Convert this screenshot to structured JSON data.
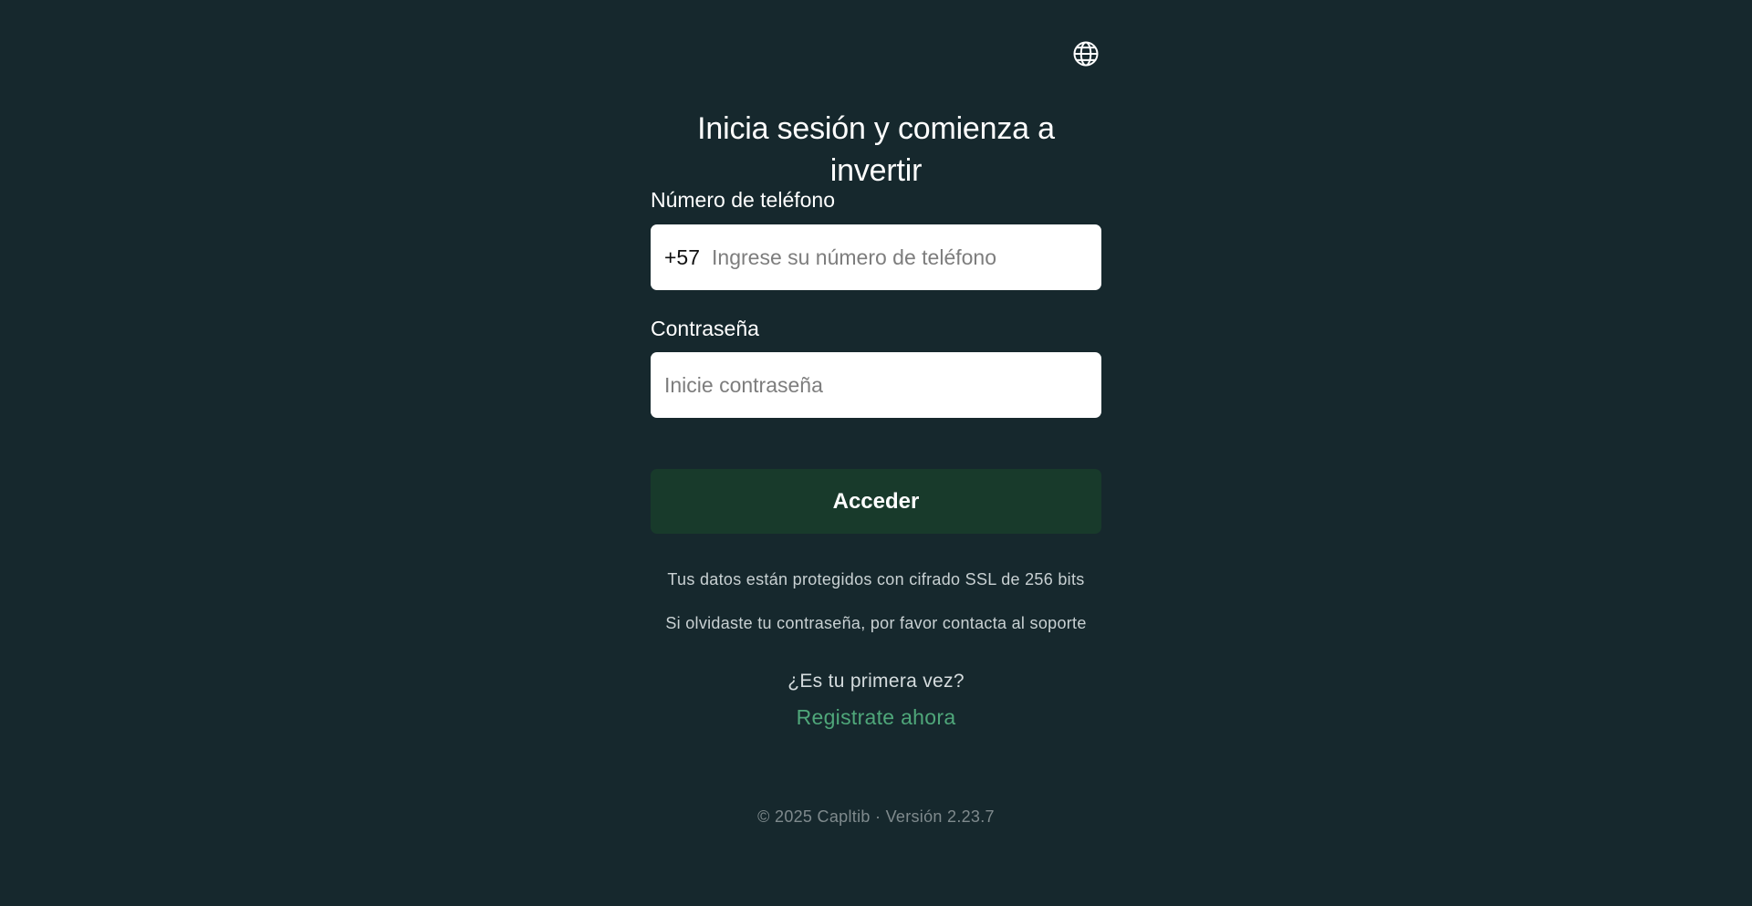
{
  "header": {
    "language_icon": "globe-icon",
    "title": "Inicia sesión y comienza a invertir"
  },
  "form": {
    "phone": {
      "label": "Número de teléfono",
      "prefix": "+57",
      "placeholder": "Ingrese su número de teléfono",
      "value": ""
    },
    "password": {
      "label": "Contraseña",
      "placeholder": "Inicie contraseña",
      "value": ""
    },
    "submit_label": "Acceder"
  },
  "notes": {
    "ssl": "Tus datos están protegidos con cifrado SSL de 256 bits",
    "forgot": "Si olvidaste tu contraseña, por favor contacta al soporte"
  },
  "signup": {
    "question": "¿Es tu primera vez?",
    "link": "Registrate ahora"
  },
  "footer": {
    "text": "© 2025 Capltib · Versión 2.23.7"
  },
  "colors": {
    "background": "#16282d",
    "button": "#183a2b",
    "link": "#4fa77a",
    "input_bg": "#ffffff"
  }
}
